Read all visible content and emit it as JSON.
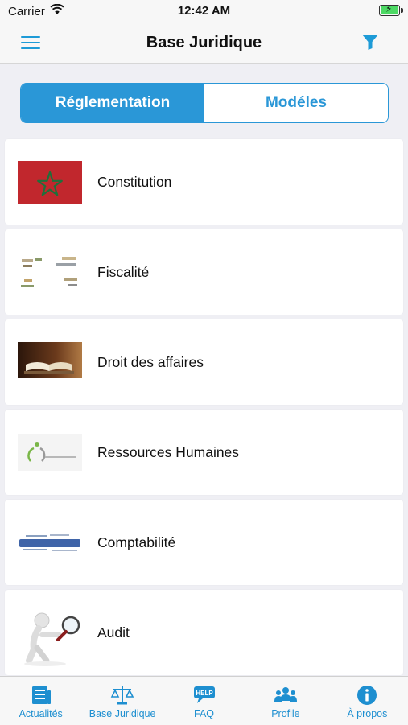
{
  "status_bar": {
    "carrier": "Carrier",
    "time": "12:42 AM"
  },
  "nav": {
    "title": "Base Juridique",
    "menu_icon": "hamburger-menu-icon",
    "filter_icon": "filter-icon"
  },
  "segments": [
    {
      "label": "Réglementation",
      "selected": true
    },
    {
      "label": "Modéles",
      "selected": false
    }
  ],
  "categories": [
    {
      "label": "Constitution",
      "icon": "morocco-flag-image"
    },
    {
      "label": "Fiscalité",
      "icon": "fiscalite-word-cloud-image"
    },
    {
      "label": "Droit des affaires",
      "icon": "open-book-image"
    },
    {
      "label": " Ressources Humaines",
      "icon": "rh-logo-image"
    },
    {
      "label": "Comptabilité",
      "icon": "comptabilite-word-cloud-image"
    },
    {
      "label": "Audit",
      "icon": "magnifier-figure-image"
    }
  ],
  "tabs": [
    {
      "label": "Actualités",
      "icon": "news-icon"
    },
    {
      "label": "Base Juridique",
      "icon": "scales-icon"
    },
    {
      "label": "FAQ",
      "icon": "help-chat-icon"
    },
    {
      "label": "Profile",
      "icon": "people-icon"
    },
    {
      "label": "À propos",
      "icon": "info-icon"
    }
  ],
  "colors": {
    "accent": "#2a97d7",
    "tab_tint": "#1e8fd0",
    "background": "#efeff4"
  }
}
